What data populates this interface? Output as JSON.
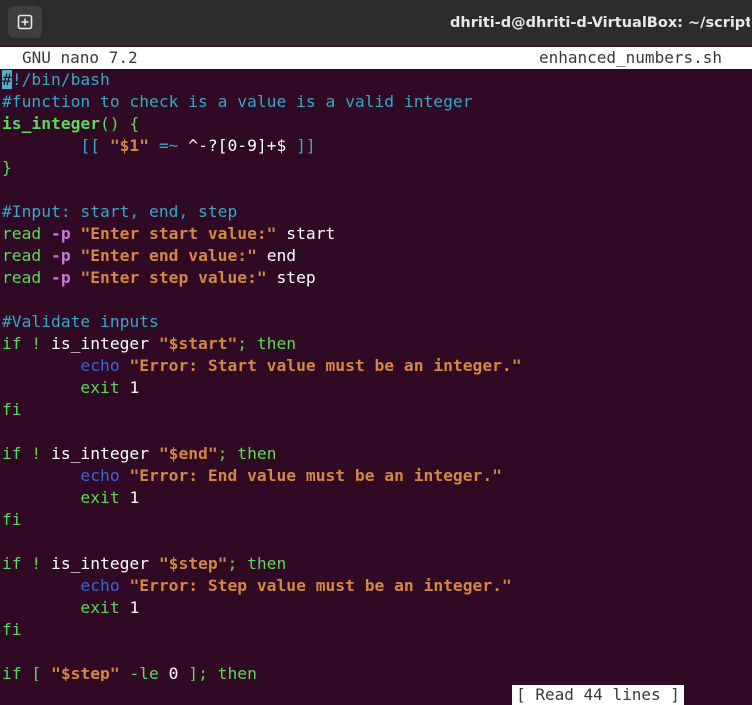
{
  "window": {
    "title": "dhriti-d@dhriti-d-VirtualBox: ~/scripts",
    "new_tab_icon": "new-tab-icon"
  },
  "nano": {
    "version": "GNU nano 7.2",
    "filename": "enhanced_numbers.sh",
    "status": "[ Read 44 lines ]"
  },
  "colors": {
    "terminal_bg": "#300a24",
    "comment": "#36a7c7",
    "function": "#5cd85c",
    "string": "#d28844",
    "option": "#c678dd",
    "builtin": "#3b64d6",
    "cursor": "#4fb0c9"
  },
  "editor": {
    "lines": [
      [
        {
          "t": "#",
          "c": "cursor"
        },
        {
          "t": "!/bin/bash",
          "c": "comment"
        }
      ],
      [
        {
          "t": "#function to check is a value is a valid integer",
          "c": "comment"
        }
      ],
      [
        {
          "t": "is_integer",
          "c": "func"
        },
        {
          "t": "() {",
          "c": "brace"
        }
      ],
      [
        {
          "t": "        [[ ",
          "c": "comment"
        },
        {
          "t": "\"$1\"",
          "c": "str"
        },
        {
          "t": " =~ ",
          "c": "comment"
        },
        {
          "t": "^-?[0-9]+$",
          "c": "plain"
        },
        {
          "t": " ]]",
          "c": "comment"
        }
      ],
      [
        {
          "t": "}",
          "c": "brace"
        }
      ],
      [],
      [
        {
          "t": "#Input: start, end, step",
          "c": "comment"
        }
      ],
      [
        {
          "t": "read ",
          "c": "kw"
        },
        {
          "t": "-p",
          "c": "opt"
        },
        {
          "t": " ",
          "c": "plain"
        },
        {
          "t": "\"Enter start value:\"",
          "c": "str"
        },
        {
          "t": " start",
          "c": "plain"
        }
      ],
      [
        {
          "t": "read ",
          "c": "kw"
        },
        {
          "t": "-p",
          "c": "opt"
        },
        {
          "t": " ",
          "c": "plain"
        },
        {
          "t": "\"Enter end value:\"",
          "c": "str"
        },
        {
          "t": " end",
          "c": "plain"
        }
      ],
      [
        {
          "t": "read ",
          "c": "kw"
        },
        {
          "t": "-p",
          "c": "opt"
        },
        {
          "t": " ",
          "c": "plain"
        },
        {
          "t": "\"Enter step value:\"",
          "c": "str"
        },
        {
          "t": " step",
          "c": "plain"
        }
      ],
      [],
      [
        {
          "t": "#Validate inputs",
          "c": "comment"
        }
      ],
      [
        {
          "t": "if ! ",
          "c": "kw"
        },
        {
          "t": "is_integer ",
          "c": "plain"
        },
        {
          "t": "\"$start\"",
          "c": "str"
        },
        {
          "t": "; then",
          "c": "kw"
        }
      ],
      [
        {
          "t": "        ",
          "c": "plain"
        },
        {
          "t": "echo",
          "c": "builtin"
        },
        {
          "t": " ",
          "c": "plain"
        },
        {
          "t": "\"Error: Start value must be an integer.\"",
          "c": "str"
        }
      ],
      [
        {
          "t": "        ",
          "c": "plain"
        },
        {
          "t": "exit",
          "c": "kw"
        },
        {
          "t": " 1",
          "c": "plain"
        }
      ],
      [
        {
          "t": "fi",
          "c": "kw"
        }
      ],
      [],
      [
        {
          "t": "if ! ",
          "c": "kw"
        },
        {
          "t": "is_integer ",
          "c": "plain"
        },
        {
          "t": "\"$end\"",
          "c": "str"
        },
        {
          "t": "; then",
          "c": "kw"
        }
      ],
      [
        {
          "t": "        ",
          "c": "plain"
        },
        {
          "t": "echo",
          "c": "builtin"
        },
        {
          "t": " ",
          "c": "plain"
        },
        {
          "t": "\"Error: End value must be an integer.\"",
          "c": "str"
        }
      ],
      [
        {
          "t": "        ",
          "c": "plain"
        },
        {
          "t": "exit",
          "c": "kw"
        },
        {
          "t": " 1",
          "c": "plain"
        }
      ],
      [
        {
          "t": "fi",
          "c": "kw"
        }
      ],
      [],
      [
        {
          "t": "if ! ",
          "c": "kw"
        },
        {
          "t": "is_integer ",
          "c": "plain"
        },
        {
          "t": "\"$step\"",
          "c": "str"
        },
        {
          "t": "; then",
          "c": "kw"
        }
      ],
      [
        {
          "t": "        ",
          "c": "plain"
        },
        {
          "t": "echo",
          "c": "builtin"
        },
        {
          "t": " ",
          "c": "plain"
        },
        {
          "t": "\"Error: Step value must be an integer.\"",
          "c": "str"
        }
      ],
      [
        {
          "t": "        ",
          "c": "plain"
        },
        {
          "t": "exit",
          "c": "kw"
        },
        {
          "t": " 1",
          "c": "plain"
        }
      ],
      [
        {
          "t": "fi",
          "c": "kw"
        }
      ],
      [],
      [
        {
          "t": "if [ ",
          "c": "kw"
        },
        {
          "t": "\"$step\"",
          "c": "str"
        },
        {
          "t": " -le ",
          "c": "kw"
        },
        {
          "t": "0",
          "c": "plain"
        },
        {
          "t": " ]; then",
          "c": "kw"
        }
      ]
    ]
  }
}
